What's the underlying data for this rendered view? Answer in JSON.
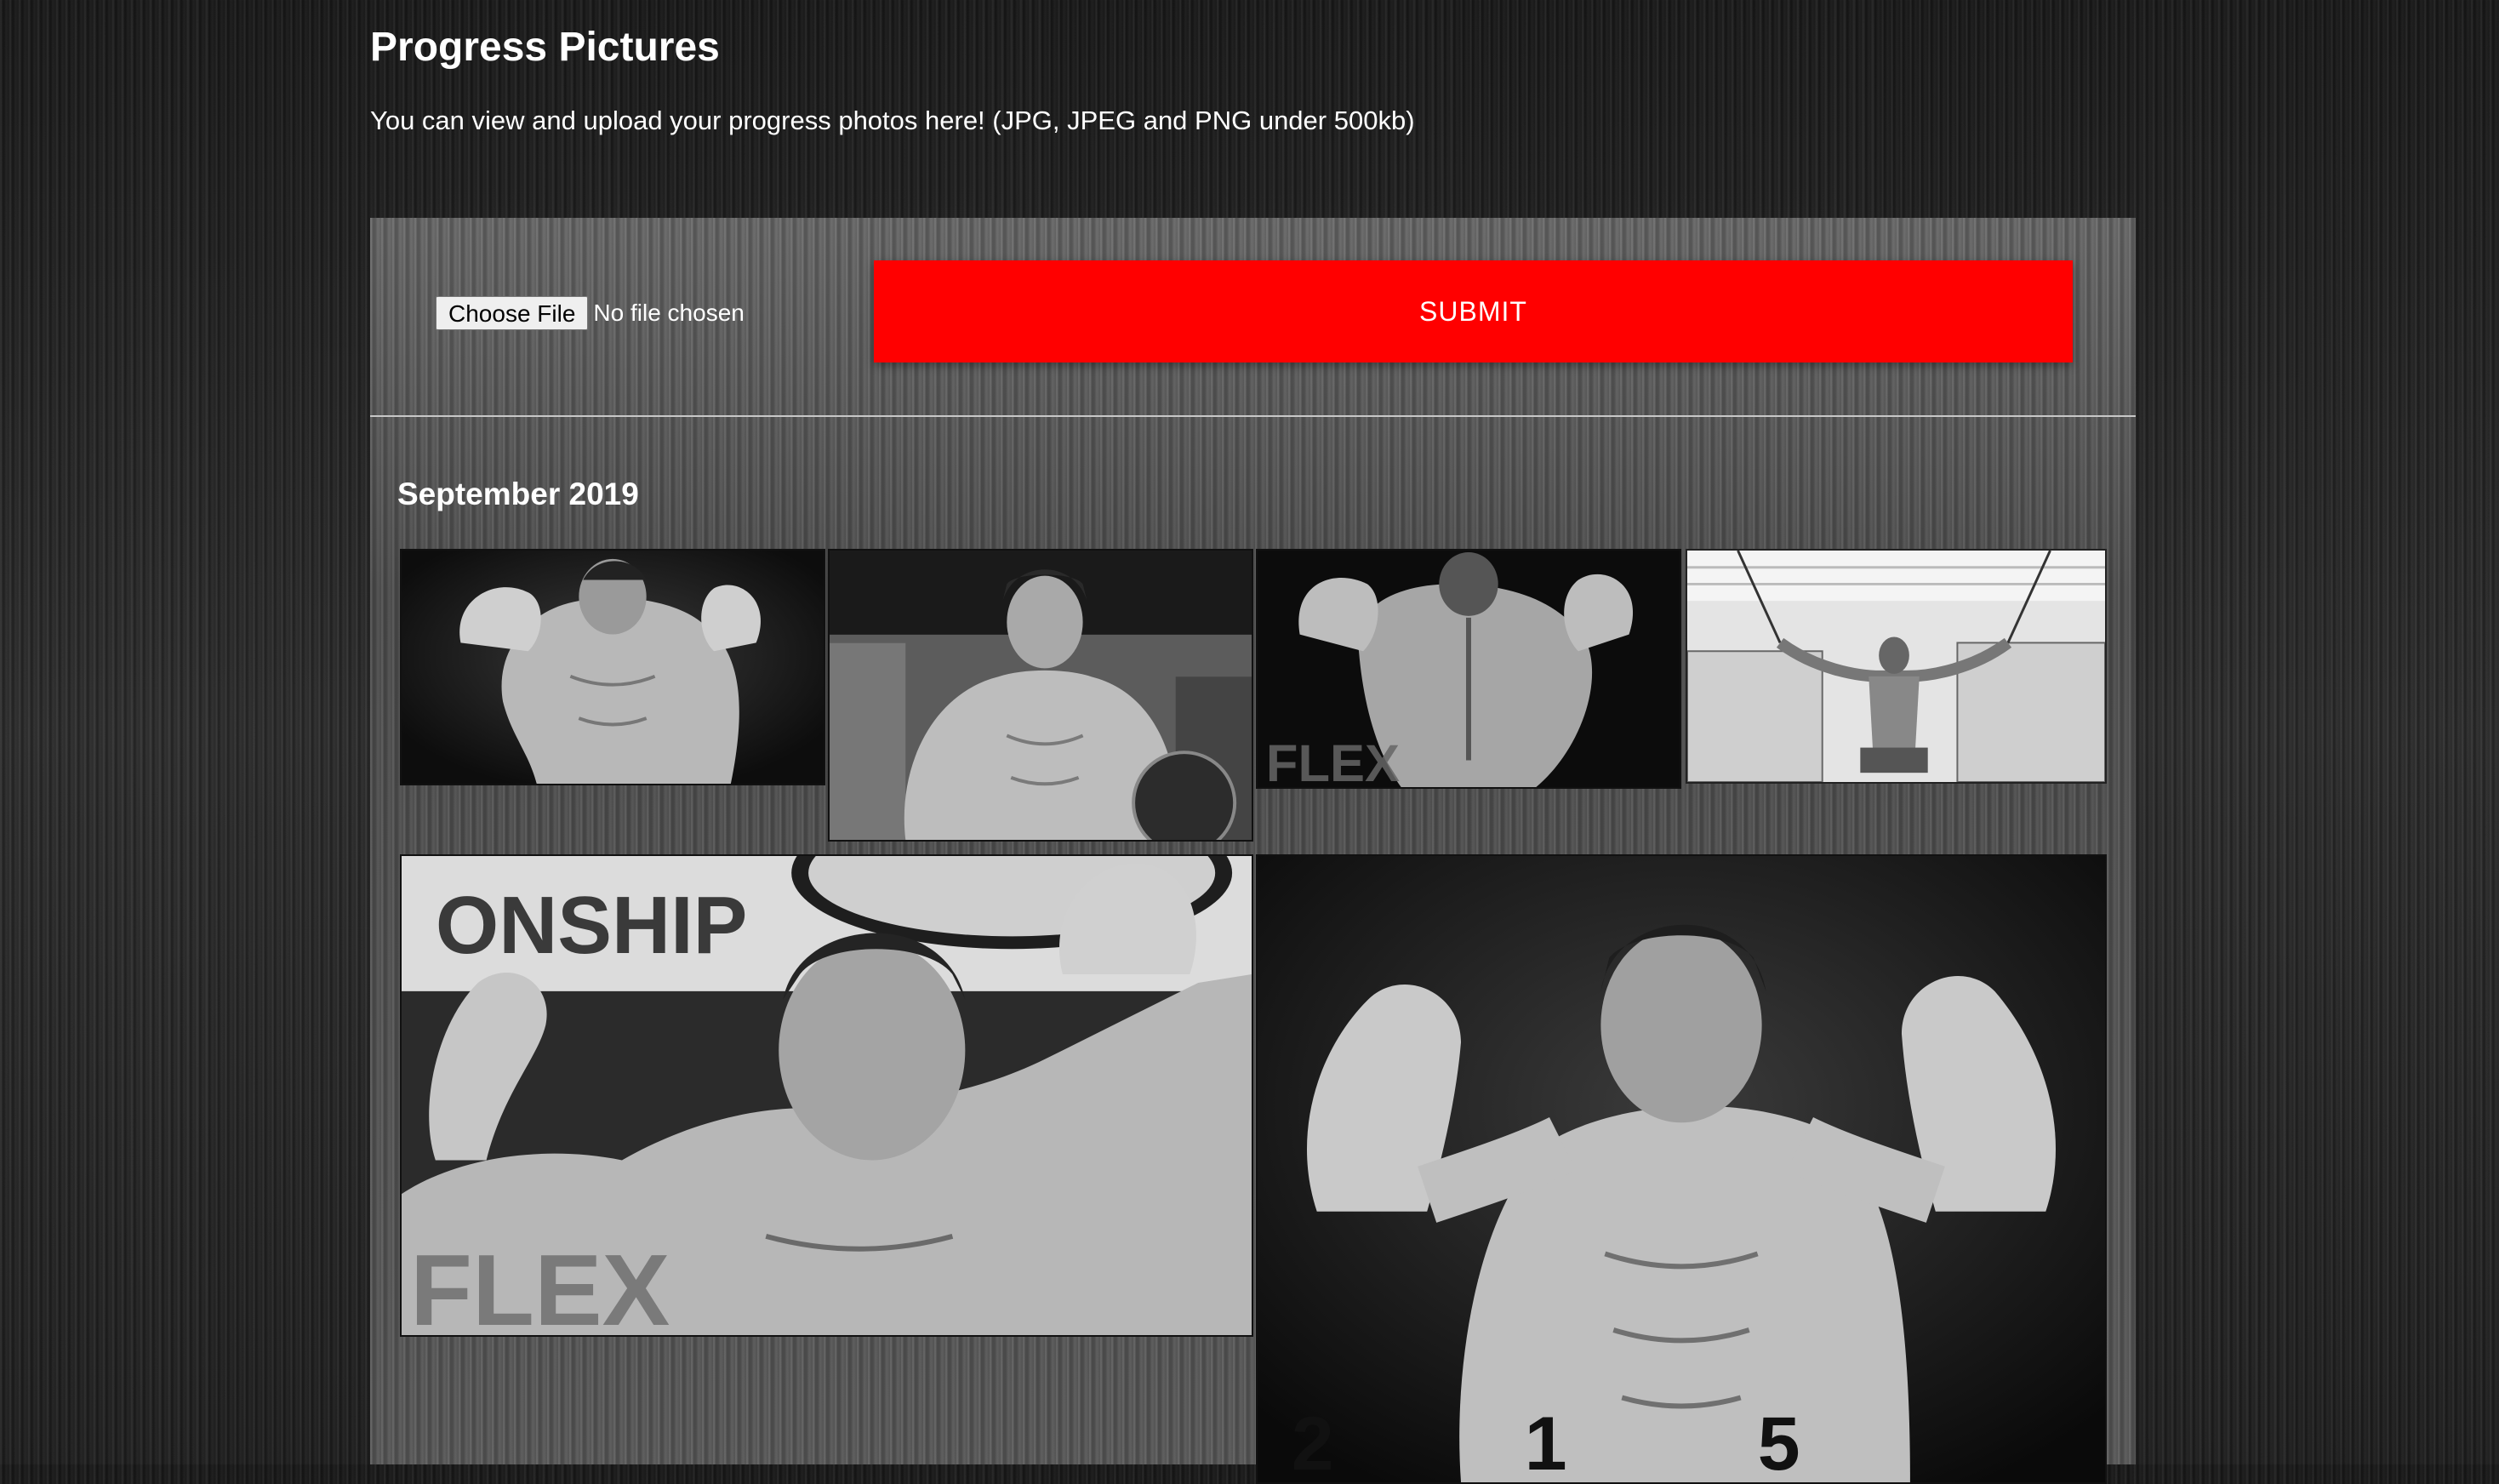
{
  "header": {
    "title": "Progress Pictures",
    "subtitle": "You can view and upload your progress photos here! (JPG, JPEG and PNG under 500kb)"
  },
  "upload": {
    "choose_label": "Choose File",
    "file_status": "No file chosen",
    "submit_label": "SUBMIT"
  },
  "gallery": {
    "month": "September 2019",
    "photos": [
      {
        "name": "photo-1",
        "watermark": ""
      },
      {
        "name": "photo-2",
        "watermark": ""
      },
      {
        "name": "photo-3",
        "watermark": "FLEX"
      },
      {
        "name": "photo-4",
        "watermark": ""
      },
      {
        "name": "photo-5",
        "watermark": "FLEX",
        "banner": "ONSHIP"
      },
      {
        "name": "photo-6",
        "watermark": "",
        "numbers": "2 1 5"
      }
    ]
  },
  "colors": {
    "accent": "#ff0000",
    "text": "#ffffff"
  }
}
